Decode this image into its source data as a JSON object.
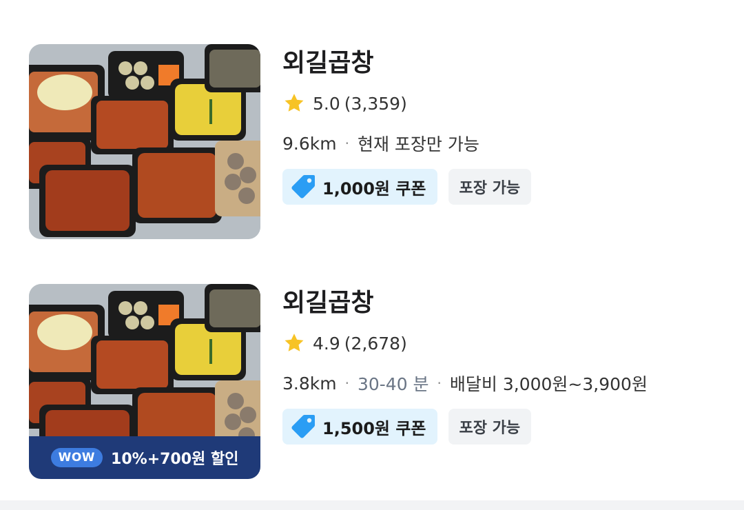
{
  "stores": [
    {
      "name": "외길곱창",
      "rating": "5.0",
      "review_count": "(3,359)",
      "distance": "9.6km",
      "status": "현재 포장만 가능",
      "coupon": "1,000원 쿠폰",
      "pickup_badge": "포장 가능"
    },
    {
      "name": "외길곱창",
      "rating": "4.9",
      "review_count": "(2,678)",
      "distance": "3.8km",
      "eta": "30-40 분",
      "delivery_fee": "배달비 3,000원~3,900원",
      "coupon": "1,500원 쿠폰",
      "pickup_badge": "포장 가능",
      "promo_pill": "WOW",
      "promo_text": "10%+700원 할인"
    }
  ],
  "separator": "·",
  "icons": {
    "rating": "star-icon",
    "coupon": "coupon-tag-icon"
  },
  "colors": {
    "star": "#f7c325",
    "coupon_bg": "#e2f3fd",
    "coupon_icon": "#2a9df4",
    "wow_banner": "#1f3a78"
  }
}
